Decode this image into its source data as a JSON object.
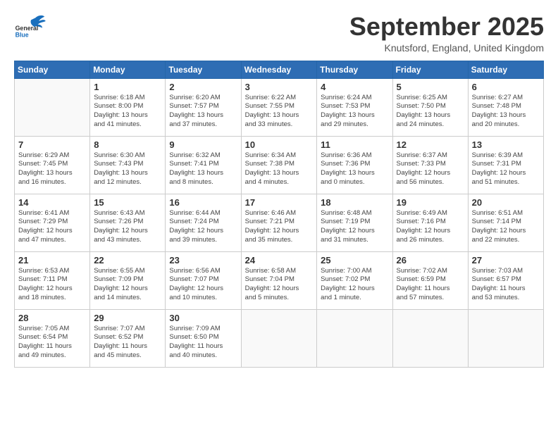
{
  "header": {
    "logo_general": "General",
    "logo_blue": "Blue",
    "month_title": "September 2025",
    "location": "Knutsford, England, United Kingdom"
  },
  "weekdays": [
    "Sunday",
    "Monday",
    "Tuesday",
    "Wednesday",
    "Thursday",
    "Friday",
    "Saturday"
  ],
  "weeks": [
    [
      {
        "day": "",
        "info": ""
      },
      {
        "day": "1",
        "info": "Sunrise: 6:18 AM\nSunset: 8:00 PM\nDaylight: 13 hours\nand 41 minutes."
      },
      {
        "day": "2",
        "info": "Sunrise: 6:20 AM\nSunset: 7:57 PM\nDaylight: 13 hours\nand 37 minutes."
      },
      {
        "day": "3",
        "info": "Sunrise: 6:22 AM\nSunset: 7:55 PM\nDaylight: 13 hours\nand 33 minutes."
      },
      {
        "day": "4",
        "info": "Sunrise: 6:24 AM\nSunset: 7:53 PM\nDaylight: 13 hours\nand 29 minutes."
      },
      {
        "day": "5",
        "info": "Sunrise: 6:25 AM\nSunset: 7:50 PM\nDaylight: 13 hours\nand 24 minutes."
      },
      {
        "day": "6",
        "info": "Sunrise: 6:27 AM\nSunset: 7:48 PM\nDaylight: 13 hours\nand 20 minutes."
      }
    ],
    [
      {
        "day": "7",
        "info": "Sunrise: 6:29 AM\nSunset: 7:45 PM\nDaylight: 13 hours\nand 16 minutes."
      },
      {
        "day": "8",
        "info": "Sunrise: 6:30 AM\nSunset: 7:43 PM\nDaylight: 13 hours\nand 12 minutes."
      },
      {
        "day": "9",
        "info": "Sunrise: 6:32 AM\nSunset: 7:41 PM\nDaylight: 13 hours\nand 8 minutes."
      },
      {
        "day": "10",
        "info": "Sunrise: 6:34 AM\nSunset: 7:38 PM\nDaylight: 13 hours\nand 4 minutes."
      },
      {
        "day": "11",
        "info": "Sunrise: 6:36 AM\nSunset: 7:36 PM\nDaylight: 13 hours\nand 0 minutes."
      },
      {
        "day": "12",
        "info": "Sunrise: 6:37 AM\nSunset: 7:33 PM\nDaylight: 12 hours\nand 56 minutes."
      },
      {
        "day": "13",
        "info": "Sunrise: 6:39 AM\nSunset: 7:31 PM\nDaylight: 12 hours\nand 51 minutes."
      }
    ],
    [
      {
        "day": "14",
        "info": "Sunrise: 6:41 AM\nSunset: 7:29 PM\nDaylight: 12 hours\nand 47 minutes."
      },
      {
        "day": "15",
        "info": "Sunrise: 6:43 AM\nSunset: 7:26 PM\nDaylight: 12 hours\nand 43 minutes."
      },
      {
        "day": "16",
        "info": "Sunrise: 6:44 AM\nSunset: 7:24 PM\nDaylight: 12 hours\nand 39 minutes."
      },
      {
        "day": "17",
        "info": "Sunrise: 6:46 AM\nSunset: 7:21 PM\nDaylight: 12 hours\nand 35 minutes."
      },
      {
        "day": "18",
        "info": "Sunrise: 6:48 AM\nSunset: 7:19 PM\nDaylight: 12 hours\nand 31 minutes."
      },
      {
        "day": "19",
        "info": "Sunrise: 6:49 AM\nSunset: 7:16 PM\nDaylight: 12 hours\nand 26 minutes."
      },
      {
        "day": "20",
        "info": "Sunrise: 6:51 AM\nSunset: 7:14 PM\nDaylight: 12 hours\nand 22 minutes."
      }
    ],
    [
      {
        "day": "21",
        "info": "Sunrise: 6:53 AM\nSunset: 7:11 PM\nDaylight: 12 hours\nand 18 minutes."
      },
      {
        "day": "22",
        "info": "Sunrise: 6:55 AM\nSunset: 7:09 PM\nDaylight: 12 hours\nand 14 minutes."
      },
      {
        "day": "23",
        "info": "Sunrise: 6:56 AM\nSunset: 7:07 PM\nDaylight: 12 hours\nand 10 minutes."
      },
      {
        "day": "24",
        "info": "Sunrise: 6:58 AM\nSunset: 7:04 PM\nDaylight: 12 hours\nand 5 minutes."
      },
      {
        "day": "25",
        "info": "Sunrise: 7:00 AM\nSunset: 7:02 PM\nDaylight: 12 hours\nand 1 minute."
      },
      {
        "day": "26",
        "info": "Sunrise: 7:02 AM\nSunset: 6:59 PM\nDaylight: 11 hours\nand 57 minutes."
      },
      {
        "day": "27",
        "info": "Sunrise: 7:03 AM\nSunset: 6:57 PM\nDaylight: 11 hours\nand 53 minutes."
      }
    ],
    [
      {
        "day": "28",
        "info": "Sunrise: 7:05 AM\nSunset: 6:54 PM\nDaylight: 11 hours\nand 49 minutes."
      },
      {
        "day": "29",
        "info": "Sunrise: 7:07 AM\nSunset: 6:52 PM\nDaylight: 11 hours\nand 45 minutes."
      },
      {
        "day": "30",
        "info": "Sunrise: 7:09 AM\nSunset: 6:50 PM\nDaylight: 11 hours\nand 40 minutes."
      },
      {
        "day": "",
        "info": ""
      },
      {
        "day": "",
        "info": ""
      },
      {
        "day": "",
        "info": ""
      },
      {
        "day": "",
        "info": ""
      }
    ]
  ]
}
